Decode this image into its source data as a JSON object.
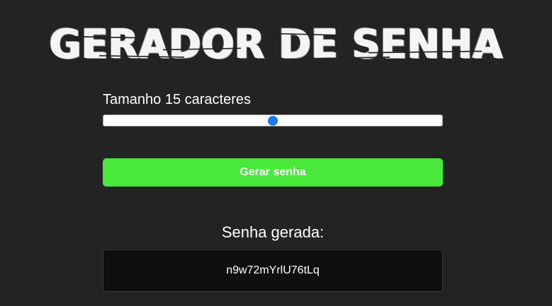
{
  "header": {
    "title": "GERADOR DE SENHA"
  },
  "length": {
    "label": "Tamanho 15 caracteres",
    "value": 15,
    "slider_fraction": 0.5
  },
  "actions": {
    "generate_label": "Gerar senha"
  },
  "result": {
    "title": "Senha gerada:",
    "password": "n9w72mYrlU76tLq"
  },
  "colors": {
    "background": "#232323",
    "button": "#48e93a",
    "slider_thumb": "#1a7cf0",
    "result_box": "#0f0f0f"
  }
}
